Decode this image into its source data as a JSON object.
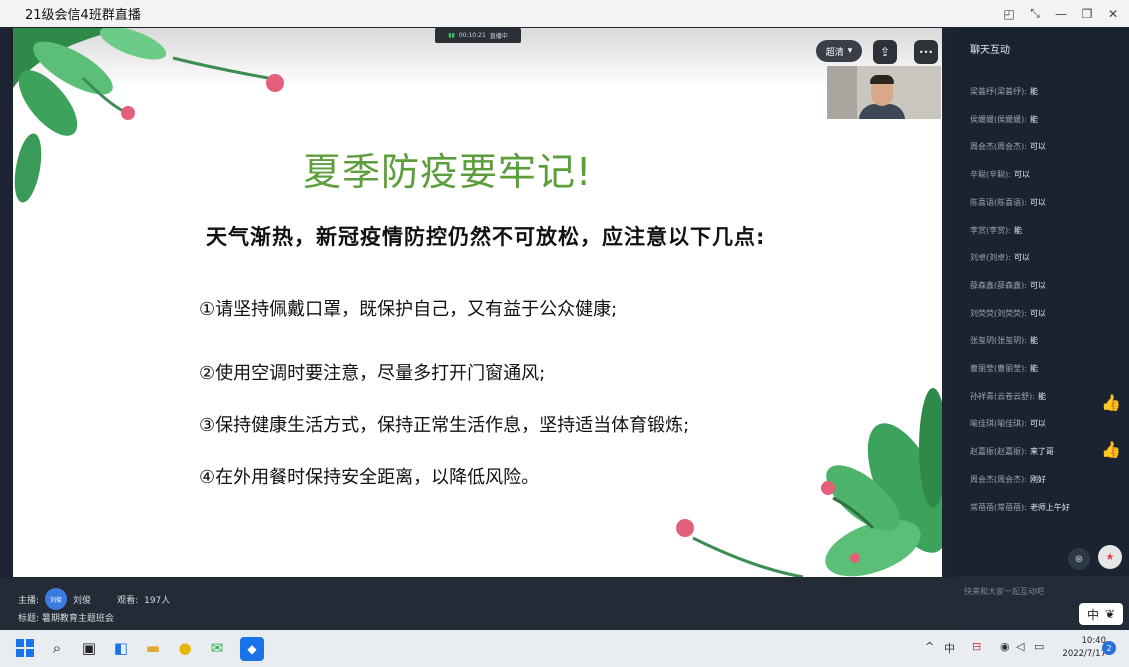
{
  "window": {
    "title": "21级会信4班群直播",
    "controls": [
      "◰",
      "⤡",
      "—",
      "❐",
      "✕"
    ]
  },
  "player": {
    "live_time": "00:10:21",
    "live_status": "直播中",
    "quality_label": "超清",
    "quality_arrow": "▾",
    "share_icon": "⇪",
    "more_icon": "•••"
  },
  "slide": {
    "title": "夏季防疫要牢记!",
    "subtitle": "天气渐热，新冠疫情防控仍然不可放松，应注意以下几点:",
    "items": [
      "①请坚持佩戴口罩，既保护自己，又有益于公众健康;",
      "②使用空调时要注意，尽量多打开门窗通风;",
      "③保持健康生活方式，保持正常生活作息，坚持适当体育锻炼;",
      "④在外用餐时保持安全距离，以降低风险。"
    ]
  },
  "info": {
    "host_label": "主播:",
    "host_avatar": "刘俊",
    "host_name": "刘俊",
    "viewers_label": "观看:",
    "viewers": "197人",
    "topic_label": "标题:",
    "topic": "暑期教育主题班会"
  },
  "chat": {
    "header": "聊天互动",
    "messages": [
      {
        "user": "梁荟纾(梁荟纾):",
        "text": "能"
      },
      {
        "user": "侯媛媛(侯媛媛):",
        "text": "能"
      },
      {
        "user": "周会杰(周会杰):",
        "text": "可以"
      },
      {
        "user": "辛聪(辛聪):",
        "text": "可以"
      },
      {
        "user": "陈喜语(陈喜语):",
        "text": "可以"
      },
      {
        "user": "李赏(李赏):",
        "text": "能"
      },
      {
        "user": "刘卓(刘卓):",
        "text": "可以"
      },
      {
        "user": "薛森鑫(薛森鑫):",
        "text": "可以"
      },
      {
        "user": "刘荧荧(刘荧荧):",
        "text": "可以"
      },
      {
        "user": "张玺玥(张玺玥):",
        "text": "能"
      },
      {
        "user": "曹丽莹(曹丽莹):",
        "text": "能"
      },
      {
        "user": "孙祥青(云卷云舒):",
        "text": "能"
      },
      {
        "user": "喻佳琪(喻佳琪):",
        "text": "可以"
      },
      {
        "user": "赵嘉振(赵嘉振):",
        "text": "来了哥"
      },
      {
        "user": "周会杰(周会杰):",
        "text": "刚好"
      },
      {
        "user": "常蓓蓓(常蓓蓓):",
        "text": "老师上午好"
      }
    ],
    "input_placeholder": "快来和大家一起互动吧",
    "gift_label": "礼物"
  },
  "ime": {
    "mode": "中",
    "icon": "❦"
  },
  "taskbar": {
    "time": "10:40",
    "date": "2022/7/17",
    "notifications": "2",
    "tray_lang": "中",
    "tray_chevron": "^"
  },
  "colors": {
    "title_green": "#5c9e3c",
    "chat_bg": "#1a2330",
    "accent_blue": "#2a6fdb"
  }
}
